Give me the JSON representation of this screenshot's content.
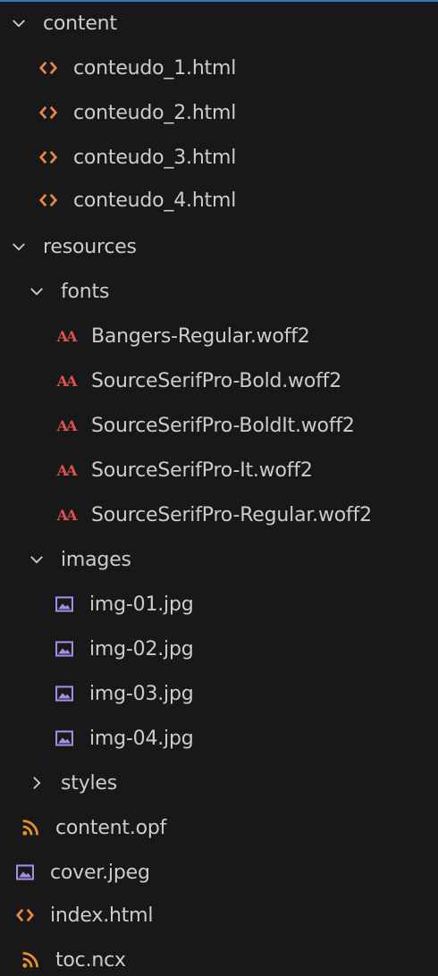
{
  "explorer": {
    "colors": {
      "background": "#181818",
      "text": "#cccccc",
      "html_icon": "#e8864a",
      "font_icon": "#e05252",
      "image_icon": "#a68ee6",
      "rss_icon": "#e8902a",
      "accent_border": "#2b79c2"
    },
    "items": [
      {
        "label": "content",
        "type": "folder",
        "expanded": true,
        "icon": "chevron-down-icon"
      },
      {
        "label": "conteudo_1.html",
        "type": "file",
        "icon": "html-file-icon"
      },
      {
        "label": "conteudo_2.html",
        "type": "file",
        "icon": "html-file-icon"
      },
      {
        "label": "conteudo_3.html",
        "type": "file",
        "icon": "html-file-icon"
      },
      {
        "label": "conteudo_4.html",
        "type": "file",
        "icon": "html-file-icon"
      },
      {
        "label": "resources",
        "type": "folder",
        "expanded": true,
        "icon": "chevron-down-icon"
      },
      {
        "label": "fonts",
        "type": "folder",
        "expanded": true,
        "icon": "chevron-down-icon"
      },
      {
        "label": "Bangers-Regular.woff2",
        "type": "file",
        "icon": "font-file-icon"
      },
      {
        "label": "SourceSerifPro-Bold.woff2",
        "type": "file",
        "icon": "font-file-icon"
      },
      {
        "label": "SourceSerifPro-BoldIt.woff2",
        "type": "file",
        "icon": "font-file-icon"
      },
      {
        "label": "SourceSerifPro-It.woff2",
        "type": "file",
        "icon": "font-file-icon"
      },
      {
        "label": "SourceSerifPro-Regular.woff2",
        "type": "file",
        "icon": "font-file-icon"
      },
      {
        "label": "images",
        "type": "folder",
        "expanded": true,
        "icon": "chevron-down-icon"
      },
      {
        "label": "img-01.jpg",
        "type": "file",
        "icon": "image-file-icon"
      },
      {
        "label": "img-02.jpg",
        "type": "file",
        "icon": "image-file-icon"
      },
      {
        "label": "img-03.jpg",
        "type": "file",
        "icon": "image-file-icon"
      },
      {
        "label": "img-04.jpg",
        "type": "file",
        "icon": "image-file-icon"
      },
      {
        "label": "styles",
        "type": "folder",
        "expanded": false,
        "icon": "chevron-right-icon"
      },
      {
        "label": "content.opf",
        "type": "file",
        "icon": "rss-file-icon"
      },
      {
        "label": "cover.jpeg",
        "type": "file",
        "icon": "image-file-icon"
      },
      {
        "label": "index.html",
        "type": "file",
        "icon": "html-file-icon"
      },
      {
        "label": "toc.ncx",
        "type": "file",
        "icon": "rss-file-icon"
      }
    ],
    "font_icon_glyph": "AΑ"
  }
}
